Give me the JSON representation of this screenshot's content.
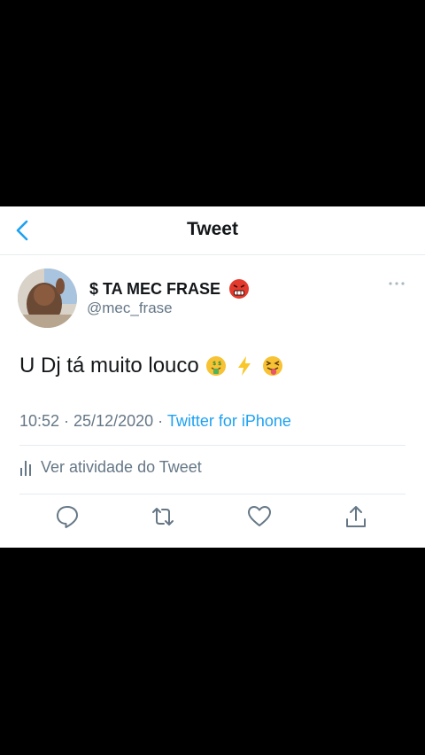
{
  "header": {
    "title": "Tweet",
    "back_icon": "chevron-left-icon"
  },
  "tweet": {
    "author_name": "$ TA MEC FRASE",
    "handle": "@mec_frase",
    "text": "U Dj tá muito louco",
    "timestamp": "10:52 · 25/12/2020 ·",
    "source": "Twitter for iPhone",
    "activity_label": "Ver atividade do Tweet"
  },
  "icons": {
    "name_emoji": "angry-face-emoji",
    "text_emojis": [
      "money-mouth-face-emoji",
      "lightning-emoji",
      "squinting-tongue-face-emoji"
    ],
    "actions": [
      "reply-icon",
      "retweet-icon",
      "like-icon",
      "share-icon"
    ],
    "more": "more-dots-icon",
    "activity": "bar-chart-icon"
  },
  "colors": {
    "accent": "#1da1f2",
    "text": "#14171a",
    "secondary": "#657786",
    "divider": "#e6ecf0",
    "background": "#000000"
  }
}
